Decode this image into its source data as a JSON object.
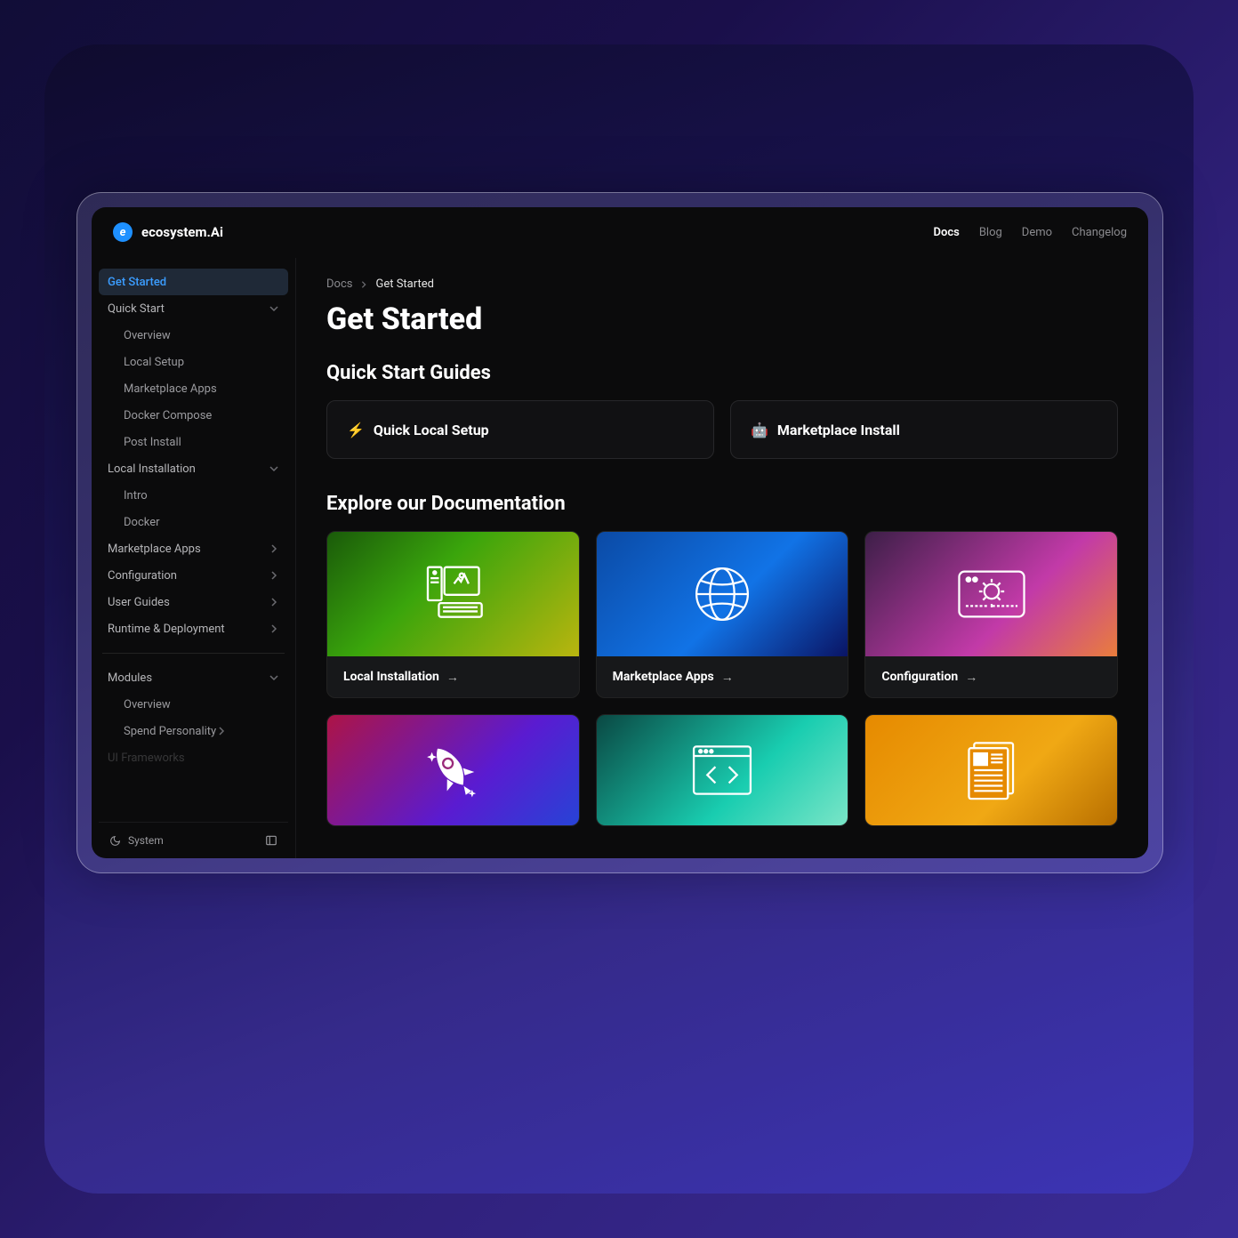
{
  "header": {
    "brand": "ecosystem.Ai",
    "nav": [
      "Docs",
      "Blog",
      "Demo",
      "Changelog"
    ],
    "active_nav": "Docs"
  },
  "sidebar": {
    "items": [
      {
        "label": "Get Started",
        "type": "item",
        "active": true
      },
      {
        "label": "Quick Start",
        "type": "item",
        "chev": "down"
      },
      {
        "label": "Overview",
        "type": "sub"
      },
      {
        "label": "Local Setup",
        "type": "sub"
      },
      {
        "label": "Marketplace Apps",
        "type": "sub"
      },
      {
        "label": "Docker Compose",
        "type": "sub"
      },
      {
        "label": "Post Install",
        "type": "sub"
      },
      {
        "label": "Local Installation",
        "type": "item",
        "chev": "down"
      },
      {
        "label": "Intro",
        "type": "sub"
      },
      {
        "label": "Docker",
        "type": "sub"
      },
      {
        "label": "Marketplace Apps",
        "type": "item",
        "chev": "right"
      },
      {
        "label": "Configuration",
        "type": "item",
        "chev": "right"
      },
      {
        "label": "User Guides",
        "type": "item",
        "chev": "right"
      },
      {
        "label": "Runtime & Deployment",
        "type": "item",
        "chev": "right"
      },
      {
        "label": "",
        "type": "divider"
      },
      {
        "label": "Modules",
        "type": "item",
        "chev": "down"
      },
      {
        "label": "Overview",
        "type": "sub"
      },
      {
        "label": "Spend Personality",
        "type": "sub",
        "chev": "right"
      },
      {
        "label": "UI Frameworks",
        "type": "item",
        "faded": true
      }
    ],
    "footer_label": "System"
  },
  "breadcrumb": {
    "root": "Docs",
    "current": "Get Started"
  },
  "page": {
    "title": "Get Started",
    "quick_title": "Quick Start Guides",
    "quick_cards": [
      {
        "emoji": "⚡",
        "label": "Quick Local Setup"
      },
      {
        "emoji": "🤖",
        "label": "Marketplace Install"
      }
    ],
    "explore_title": "Explore our Documentation",
    "doc_cards": [
      {
        "label": "Local Installation",
        "grad": "g-green",
        "icon": "pc"
      },
      {
        "label": "Marketplace Apps",
        "grad": "g-blue",
        "icon": "globe"
      },
      {
        "label": "Configuration",
        "grad": "g-pink",
        "icon": "config"
      },
      {
        "label": "",
        "grad": "g-pb",
        "icon": "rocket",
        "half": true
      },
      {
        "label": "",
        "grad": "g-teal",
        "icon": "code",
        "half": true
      },
      {
        "label": "",
        "grad": "g-org",
        "icon": "news",
        "half": true
      }
    ]
  }
}
